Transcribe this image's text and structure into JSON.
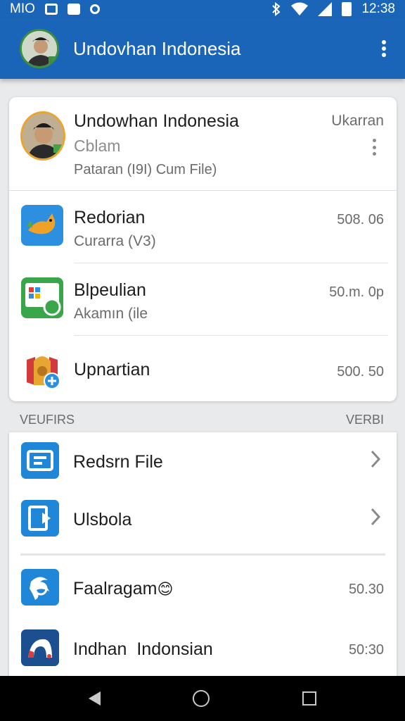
{
  "status_bar": {
    "carrier": "MIO",
    "time": "12:38",
    "icons": [
      "photo-icon",
      "mail-icon",
      "record-icon",
      "bluetooth-icon",
      "wifi-icon",
      "signal-icon",
      "battery-icon"
    ]
  },
  "app_bar": {
    "title": "Undovhan Indonesia",
    "menu_icon": "more-vert-icon"
  },
  "profile": {
    "name": "Undowhan Indonesia",
    "subtitle": "Cblam",
    "description": "Pataran (I9I) Cum File)",
    "right_label": "Ukarran"
  },
  "items": [
    {
      "title": "Redorian",
      "subtitle": "Curarra (V3)",
      "value": "508. 06",
      "icon": "fox-app-icon"
    },
    {
      "title": "Blpeulian",
      "subtitle": "Akamın (ile",
      "value": "50.m. 0p",
      "icon": "slides-app-icon"
    },
    {
      "title": "Upnartian",
      "subtitle": "",
      "value": "500. 50",
      "icon": "temple-app-icon"
    }
  ],
  "section": {
    "left": "VEUFIRS",
    "right": "VERBI"
  },
  "files": [
    {
      "title": "Redsrn File",
      "icon": "card-file-icon"
    },
    {
      "title": "Ulsbola",
      "icon": "document-file-icon"
    }
  ],
  "apps": [
    {
      "title": "Faalragam",
      "value": "50.30",
      "icon": "swirl-app-icon",
      "badge": "😊"
    },
    {
      "title": "Indhan  Indonsian",
      "value": "50:30",
      "icon": "arch-app-icon"
    }
  ],
  "colors": {
    "primary": "#1b65b8",
    "accent_blue": "#1f86d8",
    "background": "#e9eaec",
    "avatar_ring": "#e8a631"
  }
}
